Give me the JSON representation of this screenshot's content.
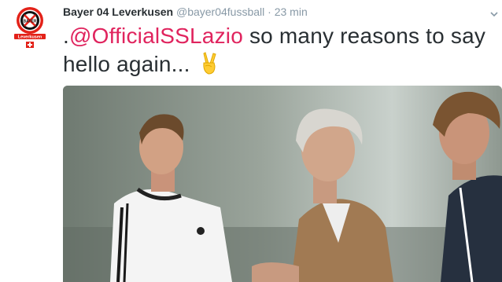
{
  "tweet": {
    "account": {
      "display_name": "Bayer 04 Leverkusen",
      "handle": "@bayer04fussball",
      "separator": "·",
      "time": "23 min",
      "avatar_icon": "bayer-04-leverkusen-crest",
      "avatar_text": "BAYER",
      "avatar_lower_text": "Leverkusen"
    },
    "text_prefix": ".",
    "mention": "@OfficialSSLazio",
    "text_body": " so many reasons to say hello again... ",
    "emoji": "victory-hand-emoji",
    "menu_icon": "chevron-down-icon",
    "colors": {
      "mention": "#e0245e",
      "text": "#292f33",
      "meta": "#8899a6",
      "crest_red": "#e32219"
    },
    "media": {
      "description_icon": "photo-image"
    }
  }
}
